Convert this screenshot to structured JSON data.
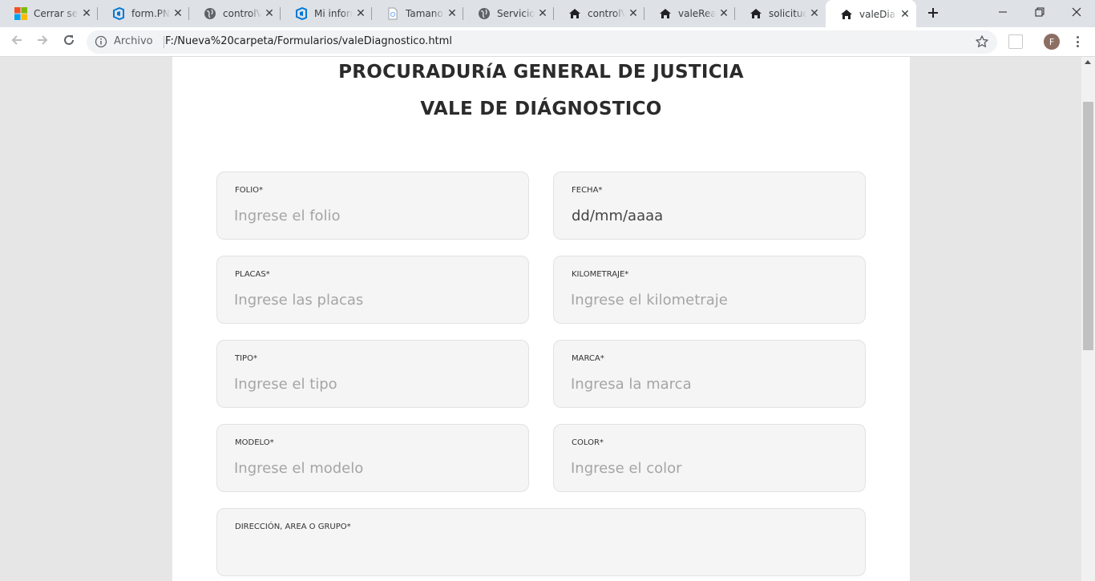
{
  "browser": {
    "tabs": [
      {
        "title": "Cerrar sesión",
        "icon": "microsoft-icon"
      },
      {
        "title": "form.PNG",
        "icon": "azure-devops-icon"
      },
      {
        "title": "controlVehicular",
        "icon": "globe-icon"
      },
      {
        "title": "Mi informe",
        "icon": "azure-devops-icon"
      },
      {
        "title": "Tamanos",
        "icon": "file-icon"
      },
      {
        "title": "Servicios",
        "icon": "globe-icon"
      },
      {
        "title": "controlVe",
        "icon": "home-icon"
      },
      {
        "title": "valeRealizacion",
        "icon": "home-icon"
      },
      {
        "title": "solicitudM",
        "icon": "home-icon"
      },
      {
        "title": "valeDiagnostico",
        "icon": "home-icon",
        "active": true
      }
    ],
    "address": {
      "security_chip": "Archivo",
      "url": "F:/Nueva%20carpeta/Formularios/valeDiagnostico.html"
    },
    "profile_initial": "F"
  },
  "page": {
    "heading1": "PROCURADURíA GENERAL DE JUSTICIA",
    "heading2": "VALE DE DIÁGNOSTICO",
    "fields": {
      "folio": {
        "label": "FOLIO*",
        "placeholder": "Ingrese el folio"
      },
      "fecha": {
        "label": "FECHA*",
        "value": "dd/mm/aaaa"
      },
      "placas": {
        "label": "PLACAS*",
        "placeholder": "Ingrese las placas"
      },
      "kilometraje": {
        "label": "KILOMETRAJE*",
        "placeholder": "Ingrese el kilometraje"
      },
      "tipo": {
        "label": "TIPO*",
        "placeholder": "Ingrese el tipo"
      },
      "marca": {
        "label": "MARCA*",
        "placeholder": "Ingresa la marca"
      },
      "modelo": {
        "label": "MODELO*",
        "placeholder": "Ingrese el modelo"
      },
      "color": {
        "label": "COLOR*",
        "placeholder": "Ingrese el color"
      },
      "direccion": {
        "label": "DIRECCIÓN, AREA O GRUPO*"
      }
    }
  },
  "colors": {
    "tabstrip": "#dee1e6",
    "page_background": "#e6e6e6",
    "field_background": "#f5f5f5",
    "heading": "#2b2b2b"
  }
}
